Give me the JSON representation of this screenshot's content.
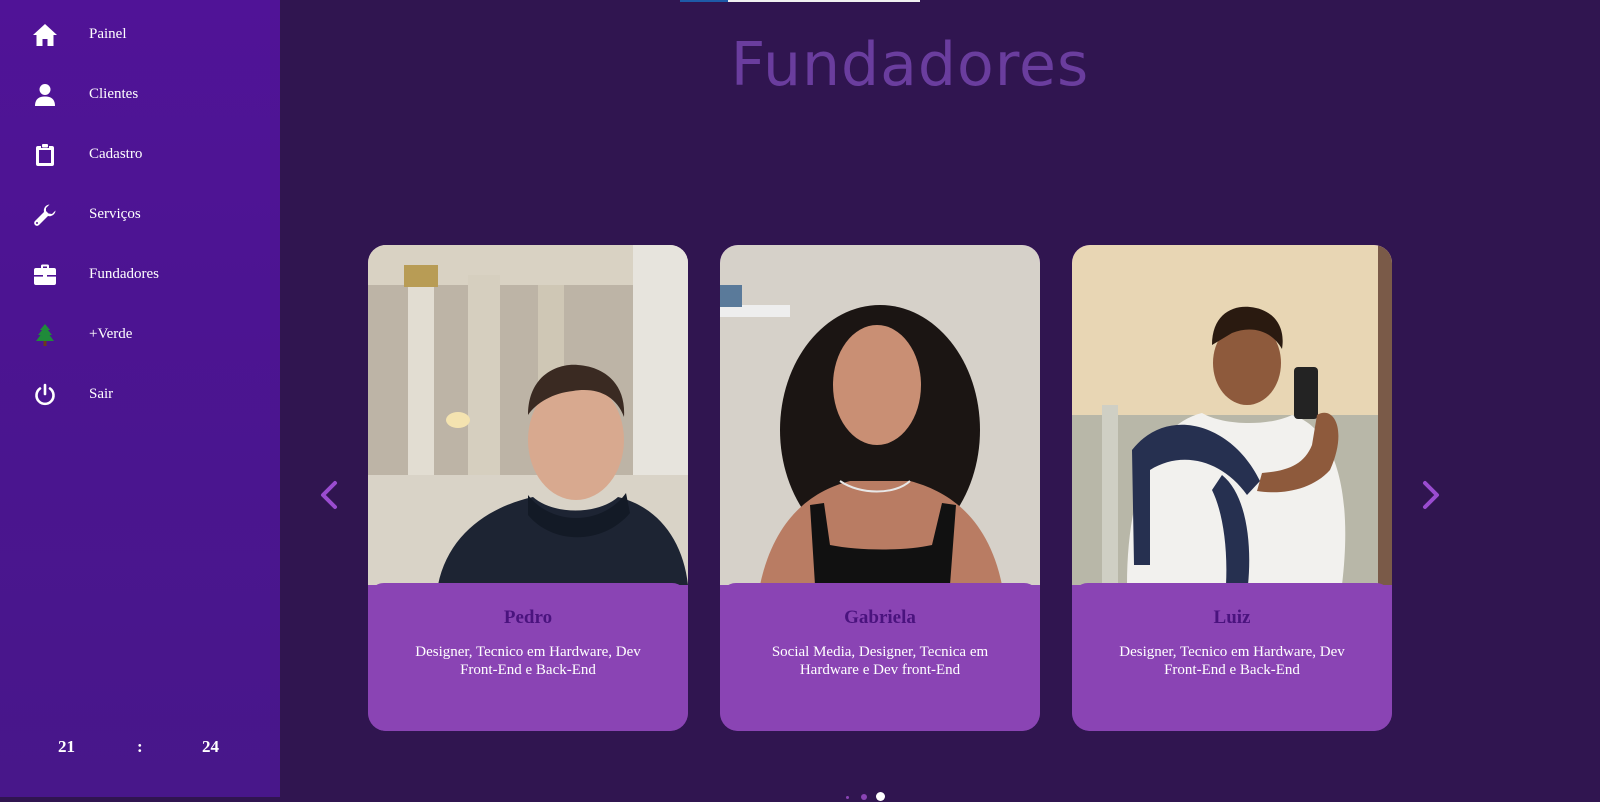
{
  "sidebar": {
    "items": [
      {
        "label": "Painel",
        "icon": "home-icon"
      },
      {
        "label": "Clientes",
        "icon": "user-icon"
      },
      {
        "label": "Cadastro",
        "icon": "clipboard-icon"
      },
      {
        "label": "Serviços",
        "icon": "wrench-icon"
      },
      {
        "label": "Fundadores",
        "icon": "briefcase-icon"
      },
      {
        "label": "+Verde",
        "icon": "tree-icon"
      },
      {
        "label": "Sair",
        "icon": "power-icon"
      }
    ],
    "clock": {
      "hours": "21",
      "separator": ":",
      "minutes": "24"
    }
  },
  "main": {
    "title": "Fundadores",
    "founders": [
      {
        "name": "Pedro",
        "role": "Designer, Tecnico em Hardware, Dev Front-End e Back-End"
      },
      {
        "name": "Gabriela",
        "role": "Social Media, Designer, Tecnica em Hardware e Dev front-End"
      },
      {
        "name": "Luiz",
        "role": "Designer, Tecnico em Hardware, Dev Front-End e Back-End"
      }
    ],
    "carousel": {
      "page_count": 3,
      "active_page": 3
    }
  },
  "colors": {
    "sidebar": "#501397",
    "background": "#301550",
    "card": "#8a44b4",
    "title": "#6a3d9e",
    "name": "#4a137e",
    "arrow": "#9a4cd0",
    "tree": "#1f8a3a"
  }
}
